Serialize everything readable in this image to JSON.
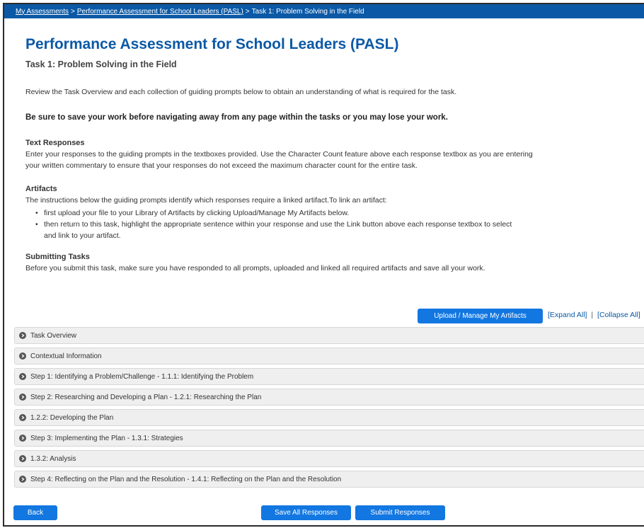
{
  "breadcrumb": {
    "items": [
      "My Assessments",
      "Performance Assessment for School Leaders (PASL)",
      "Task 1: Problem Solving in the Field"
    ],
    "separator": ">"
  },
  "header": {
    "title": "Performance Assessment for School Leaders (PASL)",
    "subtitle": "Task 1: Problem Solving in the Field"
  },
  "intro": {
    "review": "Review the Task Overview and each collection of guiding prompts below to obtain an understanding of what is required for the task.",
    "warning": "Be sure to save your work before navigating away from any page within the tasks or you may lose your work."
  },
  "text_responses": {
    "title": "Text Responses",
    "line1": "Enter your responses to the guiding prompts in the textboxes provided. Use the Character Count feature above each response textbox as you are entering",
    "line2": "your written commentary to ensure that your responses do not exceed the maximum character count for the entire task."
  },
  "artifacts": {
    "title": "Artifacts",
    "intro": "The instructions below the guiding prompts identify which responses require a linked artifact.To link an artifact:",
    "bullet1": "first upload your file to your Library of Artifacts by clicking Upload/Manage My Artifacts below.",
    "bullet2_line1": "then return to this task, highlight the appropriate sentence within your response and use the Link button above each response textbox to select",
    "bullet2_line2": "and link to your artifact."
  },
  "submitting": {
    "title": "Submitting Tasks",
    "text": "Before you submit this task, make sure you have responded to all prompts, uploaded and linked all required artifacts and save all your work."
  },
  "toolbar": {
    "upload_label": "Upload / Manage My Artifacts",
    "expand_all": "[Expand All]",
    "collapse_all": "[Collapse All]",
    "pipe": "|"
  },
  "sections": [
    "Task Overview",
    "Contextual Information",
    "Step 1: Identifying a Problem/Challenge - 1.1.1: Identifying the Problem",
    "Step 2: Researching and Developing a Plan - 1.2.1: Researching the Plan",
    "1.2.2: Developing the Plan",
    "Step 3: Implementing the Plan - 1.3.1: Strategies",
    "1.3.2: Analysis",
    "Step 4: Reflecting on the Plan and the Resolution - 1.4.1: Reflecting on the Plan and the Resolution"
  ],
  "footer": {
    "back_label": "Back",
    "save_label": "Save All Responses",
    "submit_label": "Submit Responses"
  },
  "colors": {
    "brand_blue": "#0b59a6",
    "button_blue": "#1277e1",
    "accordion_bg": "#efefef"
  },
  "icons": {
    "accordion": "circle-chevron-right-icon"
  }
}
